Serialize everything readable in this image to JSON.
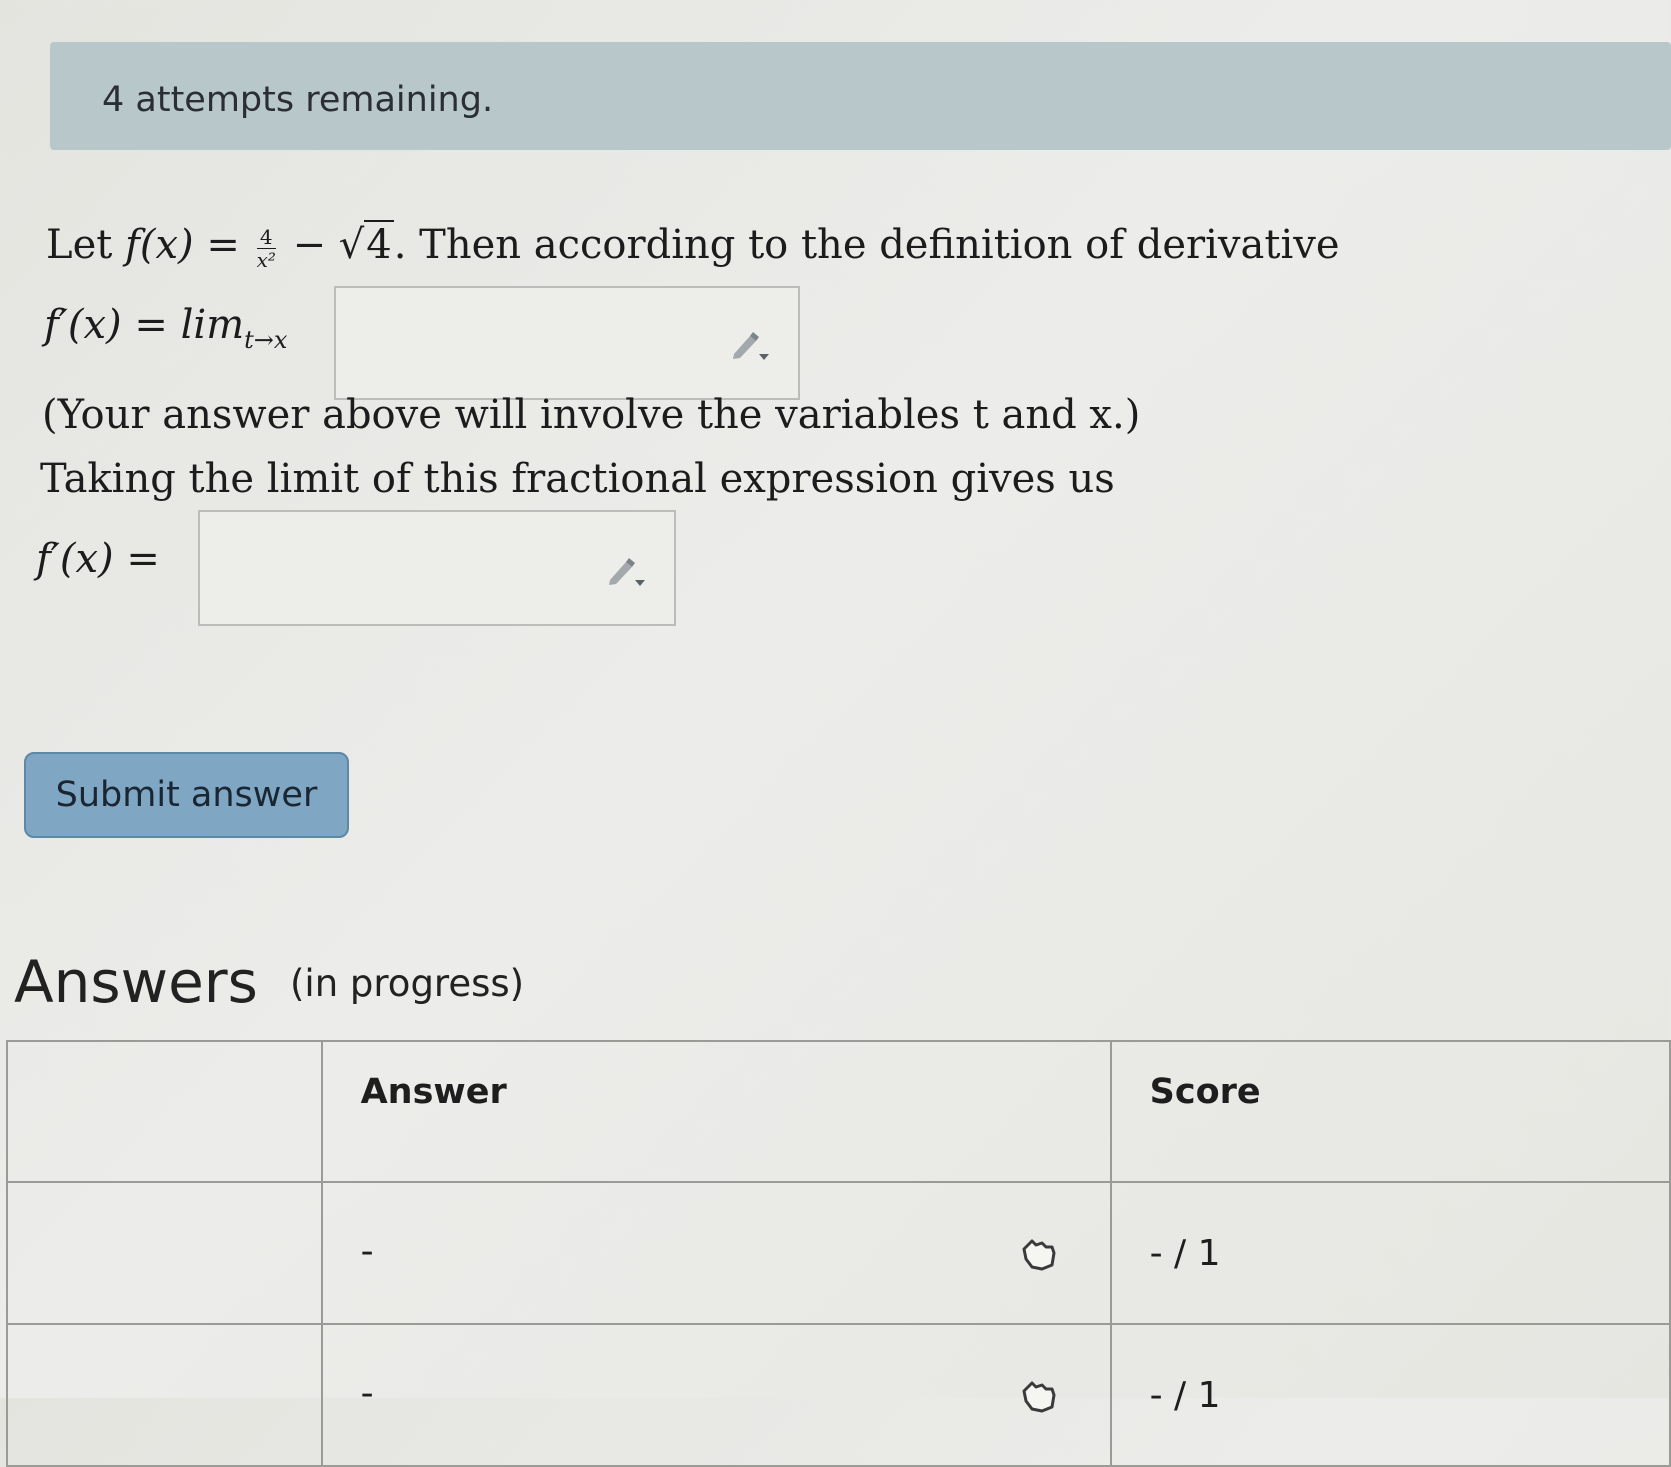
{
  "banner": {
    "attempts_text": "4 attempts remaining."
  },
  "question": {
    "intro": "Let ",
    "fx": "f(x) = ",
    "frac_num": "4",
    "frac_den": "x²",
    "minus_sqrt": " − √",
    "sqrt_arg": "4",
    "after": ". Then according to the definition of derivative",
    "limit_lhs": "f′(x) = lim",
    "limit_sub": "t→x",
    "note": "(Your answer above will involve the variables t and x.)",
    "taking": "Taking the limit of this fractional expression gives us",
    "fprime_lhs": "f′(x) ="
  },
  "submit": {
    "label": "Submit answer"
  },
  "answers": {
    "title": "Answers",
    "status": "(in progress)",
    "columns": [
      "",
      "Answer",
      "Score"
    ],
    "rows": [
      {
        "answer": "-",
        "score": "- / 1"
      },
      {
        "answer": "-",
        "score": "- / 1"
      }
    ]
  },
  "icons": {
    "input_tool": "pencil-dropdown-icon",
    "row_action": "pointing-hand-icon"
  }
}
